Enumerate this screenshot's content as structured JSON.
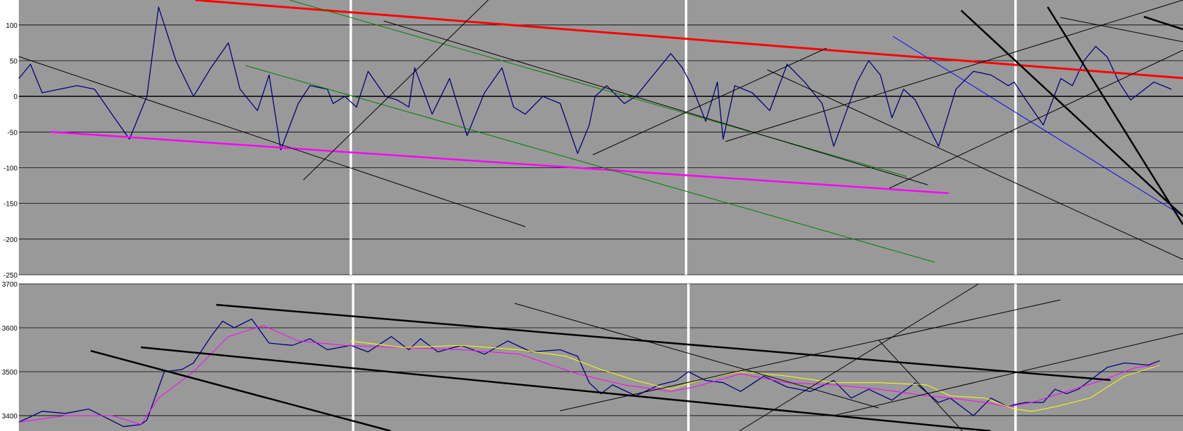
{
  "colors": {
    "plot_bg": "#999999",
    "page_bg": "#ffffff",
    "price_series": "#000080",
    "grid": "#000000",
    "red_trendline": "#ff0000",
    "magenta_trendline": "#ff00ff",
    "green_trendline": "#008000",
    "blue_trendline": "#0000ff",
    "black_trendline": "#000000",
    "ma_magenta": "#ff00ff",
    "ma_yellow": "#ffff00",
    "separator": "#ffffff"
  },
  "chart_data": [
    {
      "type": "line",
      "name": "oscillator",
      "title": "",
      "xlabel": "",
      "ylabel": "",
      "ylim": [
        -250,
        135
      ],
      "yticks": [
        100,
        50,
        0,
        -50,
        -100,
        -150,
        -200,
        -250
      ],
      "ytick_labels": [
        "100",
        "50",
        "0",
        "-50",
        "-100",
        "-150",
        "-200",
        "-250"
      ],
      "x_range": [
        0,
        1000
      ],
      "grid": true,
      "legend": "none",
      "panel_separators_x": [
        285,
        573,
        856
      ],
      "series": [
        {
          "color": "#000080",
          "x": [
            0,
            10,
            20,
            35,
            50,
            65,
            80,
            95,
            105,
            110,
            120,
            135,
            150,
            165,
            180,
            190,
            205,
            215,
            225,
            240,
            250,
            265,
            270,
            280,
            290,
            300,
            315,
            325,
            335,
            340,
            355,
            370,
            385,
            400,
            415,
            425,
            435,
            450,
            465,
            480,
            490,
            495,
            505,
            520,
            530,
            545,
            560,
            570,
            578,
            590,
            600,
            605,
            615,
            630,
            645,
            660,
            675,
            690,
            700,
            720,
            730,
            740,
            750,
            760,
            770,
            790,
            805,
            820,
            835,
            850,
            855,
            865,
            880,
            895,
            905,
            915,
            925,
            935,
            945,
            955,
            975,
            990
          ],
          "y": [
            25,
            45,
            5,
            10,
            15,
            10,
            -25,
            -60,
            -20,
            0,
            125,
            50,
            0,
            40,
            75,
            10,
            -20,
            30,
            -75,
            -10,
            15,
            10,
            -10,
            0,
            -15,
            35,
            0,
            -5,
            -15,
            40,
            -25,
            25,
            -55,
            5,
            40,
            -15,
            -25,
            0,
            -10,
            -80,
            -40,
            0,
            15,
            -10,
            0,
            30,
            60,
            40,
            15,
            -35,
            20,
            -60,
            15,
            5,
            -20,
            45,
            20,
            -10,
            -70,
            20,
            50,
            30,
            -30,
            10,
            -5,
            -70,
            10,
            35,
            30,
            15,
            20,
            -5,
            -40,
            25,
            15,
            50,
            70,
            55,
            20,
            -5,
            20,
            10
          ]
        }
      ]
    },
    {
      "type": "line",
      "name": "price",
      "title": "",
      "xlabel": "",
      "ylabel": "",
      "ylim": [
        3365,
        3700
      ],
      "yticks": [
        3700,
        3600,
        3500,
        3400
      ],
      "ytick_labels": [
        "3700",
        "3600",
        "3500",
        "3400"
      ],
      "x_range": [
        0,
        1000
      ],
      "grid": true,
      "legend": "none",
      "panel_separators_x": [
        287,
        575,
        856
      ],
      "series": [
        {
          "color": "#000080",
          "x": [
            0,
            20,
            40,
            60,
            75,
            90,
            105,
            110,
            125,
            140,
            150,
            165,
            175,
            185,
            200,
            215,
            235,
            250,
            265,
            285,
            300,
            320,
            335,
            345,
            360,
            380,
            400,
            420,
            440,
            465,
            480,
            490,
            500,
            510,
            530,
            550,
            565,
            575,
            590,
            605,
            620,
            640,
            660,
            680,
            700,
            715,
            730,
            750,
            770,
            790,
            800,
            820,
            835,
            850,
            855,
            865,
            880,
            890,
            900,
            910,
            920,
            935,
            950,
            970,
            980
          ],
          "y": [
            3385,
            3410,
            3405,
            3415,
            3395,
            3375,
            3380,
            3390,
            3500,
            3505,
            3520,
            3580,
            3615,
            3600,
            3620,
            3565,
            3560,
            3575,
            3550,
            3560,
            3545,
            3580,
            3550,
            3575,
            3545,
            3560,
            3540,
            3570,
            3545,
            3550,
            3535,
            3475,
            3450,
            3470,
            3445,
            3470,
            3480,
            3500,
            3480,
            3475,
            3455,
            3490,
            3465,
            3455,
            3480,
            3440,
            3460,
            3435,
            3475,
            3430,
            3440,
            3400,
            3440,
            3420,
            3425,
            3430,
            3430,
            3460,
            3450,
            3460,
            3480,
            3510,
            3520,
            3515,
            3525
          ]
        },
        {
          "color": "#ff00ff",
          "x": [
            0,
            40,
            80,
            105,
            120,
            150,
            180,
            210,
            240,
            280,
            330,
            380,
            430,
            480,
            520,
            560,
            580,
            620,
            660,
            700,
            740,
            780,
            800,
            830,
            850,
            870,
            900,
            930,
            960,
            980
          ],
          "y": [
            3385,
            3400,
            3400,
            3380,
            3440,
            3500,
            3580,
            3605,
            3570,
            3560,
            3555,
            3550,
            3540,
            3495,
            3470,
            3455,
            3465,
            3495,
            3475,
            3470,
            3460,
            3445,
            3440,
            3430,
            3420,
            3430,
            3455,
            3480,
            3510,
            3515
          ]
        },
        {
          "color": "#ffff00",
          "x": [
            285,
            330,
            380,
            430,
            470,
            500,
            530,
            560,
            590,
            620,
            660,
            700,
            740,
            780,
            800,
            830,
            855,
            870,
            890,
            920,
            950,
            980
          ],
          "y": [
            3570,
            3555,
            3560,
            3550,
            3535,
            3505,
            3480,
            3460,
            3485,
            3500,
            3490,
            3475,
            3475,
            3470,
            3445,
            3440,
            3415,
            3410,
            3420,
            3440,
            3490,
            3515
          ]
        }
      ]
    }
  ]
}
